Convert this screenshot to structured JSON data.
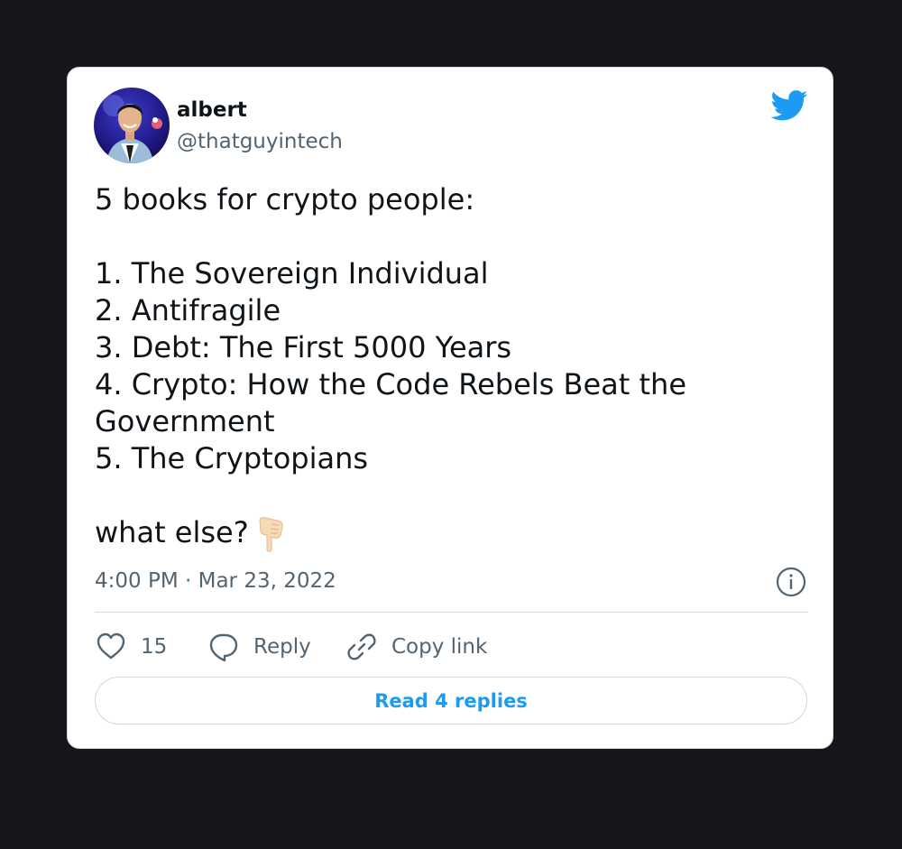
{
  "author": {
    "display_name": "albert",
    "handle": "@thatguyintech"
  },
  "tweet": {
    "lines": [
      "5 books for crypto people:",
      "",
      "1. The Sovereign Individual",
      "2. Antifragile",
      "3. Debt: The First 5000 Years",
      "4. Crypto: How the Code Rebels Beat the",
      "Government",
      "5. The Cryptopians",
      "",
      "what else?"
    ],
    "emoji": "backhand-index-pointing-down-emoji",
    "timestamp": "4:00 PM · Mar 23, 2022"
  },
  "actions": {
    "like_count": "15",
    "reply_label": "Reply",
    "copy_label": "Copy link"
  },
  "read_replies_label": "Read 4 replies",
  "icons": {
    "brand": "twitter-bird-icon",
    "info": "info-icon",
    "like": "heart-icon",
    "reply": "reply-bubble-icon",
    "copy": "link-icon"
  },
  "colors": {
    "brand_blue": "#1d9bf0",
    "text_primary": "#0f1419",
    "text_secondary": "#536471",
    "border": "#cfd9de",
    "page_background": "#15151a"
  }
}
